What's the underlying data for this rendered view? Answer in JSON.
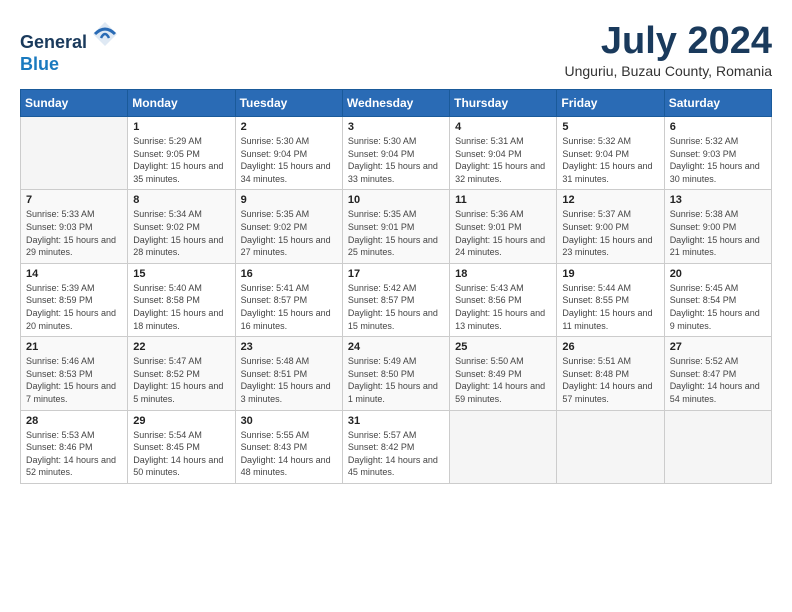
{
  "logo": {
    "line1": "General",
    "line2": "Blue"
  },
  "header": {
    "month": "July 2024",
    "location": "Unguriu, Buzau County, Romania"
  },
  "weekdays": [
    "Sunday",
    "Monday",
    "Tuesday",
    "Wednesday",
    "Thursday",
    "Friday",
    "Saturday"
  ],
  "weeks": [
    [
      {
        "day": "",
        "sunrise": "",
        "sunset": "",
        "daylight": ""
      },
      {
        "day": "1",
        "sunrise": "Sunrise: 5:29 AM",
        "sunset": "Sunset: 9:05 PM",
        "daylight": "Daylight: 15 hours and 35 minutes."
      },
      {
        "day": "2",
        "sunrise": "Sunrise: 5:30 AM",
        "sunset": "Sunset: 9:04 PM",
        "daylight": "Daylight: 15 hours and 34 minutes."
      },
      {
        "day": "3",
        "sunrise": "Sunrise: 5:30 AM",
        "sunset": "Sunset: 9:04 PM",
        "daylight": "Daylight: 15 hours and 33 minutes."
      },
      {
        "day": "4",
        "sunrise": "Sunrise: 5:31 AM",
        "sunset": "Sunset: 9:04 PM",
        "daylight": "Daylight: 15 hours and 32 minutes."
      },
      {
        "day": "5",
        "sunrise": "Sunrise: 5:32 AM",
        "sunset": "Sunset: 9:04 PM",
        "daylight": "Daylight: 15 hours and 31 minutes."
      },
      {
        "day": "6",
        "sunrise": "Sunrise: 5:32 AM",
        "sunset": "Sunset: 9:03 PM",
        "daylight": "Daylight: 15 hours and 30 minutes."
      }
    ],
    [
      {
        "day": "7",
        "sunrise": "Sunrise: 5:33 AM",
        "sunset": "Sunset: 9:03 PM",
        "daylight": "Daylight: 15 hours and 29 minutes."
      },
      {
        "day": "8",
        "sunrise": "Sunrise: 5:34 AM",
        "sunset": "Sunset: 9:02 PM",
        "daylight": "Daylight: 15 hours and 28 minutes."
      },
      {
        "day": "9",
        "sunrise": "Sunrise: 5:35 AM",
        "sunset": "Sunset: 9:02 PM",
        "daylight": "Daylight: 15 hours and 27 minutes."
      },
      {
        "day": "10",
        "sunrise": "Sunrise: 5:35 AM",
        "sunset": "Sunset: 9:01 PM",
        "daylight": "Daylight: 15 hours and 25 minutes."
      },
      {
        "day": "11",
        "sunrise": "Sunrise: 5:36 AM",
        "sunset": "Sunset: 9:01 PM",
        "daylight": "Daylight: 15 hours and 24 minutes."
      },
      {
        "day": "12",
        "sunrise": "Sunrise: 5:37 AM",
        "sunset": "Sunset: 9:00 PM",
        "daylight": "Daylight: 15 hours and 23 minutes."
      },
      {
        "day": "13",
        "sunrise": "Sunrise: 5:38 AM",
        "sunset": "Sunset: 9:00 PM",
        "daylight": "Daylight: 15 hours and 21 minutes."
      }
    ],
    [
      {
        "day": "14",
        "sunrise": "Sunrise: 5:39 AM",
        "sunset": "Sunset: 8:59 PM",
        "daylight": "Daylight: 15 hours and 20 minutes."
      },
      {
        "day": "15",
        "sunrise": "Sunrise: 5:40 AM",
        "sunset": "Sunset: 8:58 PM",
        "daylight": "Daylight: 15 hours and 18 minutes."
      },
      {
        "day": "16",
        "sunrise": "Sunrise: 5:41 AM",
        "sunset": "Sunset: 8:57 PM",
        "daylight": "Daylight: 15 hours and 16 minutes."
      },
      {
        "day": "17",
        "sunrise": "Sunrise: 5:42 AM",
        "sunset": "Sunset: 8:57 PM",
        "daylight": "Daylight: 15 hours and 15 minutes."
      },
      {
        "day": "18",
        "sunrise": "Sunrise: 5:43 AM",
        "sunset": "Sunset: 8:56 PM",
        "daylight": "Daylight: 15 hours and 13 minutes."
      },
      {
        "day": "19",
        "sunrise": "Sunrise: 5:44 AM",
        "sunset": "Sunset: 8:55 PM",
        "daylight": "Daylight: 15 hours and 11 minutes."
      },
      {
        "day": "20",
        "sunrise": "Sunrise: 5:45 AM",
        "sunset": "Sunset: 8:54 PM",
        "daylight": "Daylight: 15 hours and 9 minutes."
      }
    ],
    [
      {
        "day": "21",
        "sunrise": "Sunrise: 5:46 AM",
        "sunset": "Sunset: 8:53 PM",
        "daylight": "Daylight: 15 hours and 7 minutes."
      },
      {
        "day": "22",
        "sunrise": "Sunrise: 5:47 AM",
        "sunset": "Sunset: 8:52 PM",
        "daylight": "Daylight: 15 hours and 5 minutes."
      },
      {
        "day": "23",
        "sunrise": "Sunrise: 5:48 AM",
        "sunset": "Sunset: 8:51 PM",
        "daylight": "Daylight: 15 hours and 3 minutes."
      },
      {
        "day": "24",
        "sunrise": "Sunrise: 5:49 AM",
        "sunset": "Sunset: 8:50 PM",
        "daylight": "Daylight: 15 hours and 1 minute."
      },
      {
        "day": "25",
        "sunrise": "Sunrise: 5:50 AM",
        "sunset": "Sunset: 8:49 PM",
        "daylight": "Daylight: 14 hours and 59 minutes."
      },
      {
        "day": "26",
        "sunrise": "Sunrise: 5:51 AM",
        "sunset": "Sunset: 8:48 PM",
        "daylight": "Daylight: 14 hours and 57 minutes."
      },
      {
        "day": "27",
        "sunrise": "Sunrise: 5:52 AM",
        "sunset": "Sunset: 8:47 PM",
        "daylight": "Daylight: 14 hours and 54 minutes."
      }
    ],
    [
      {
        "day": "28",
        "sunrise": "Sunrise: 5:53 AM",
        "sunset": "Sunset: 8:46 PM",
        "daylight": "Daylight: 14 hours and 52 minutes."
      },
      {
        "day": "29",
        "sunrise": "Sunrise: 5:54 AM",
        "sunset": "Sunset: 8:45 PM",
        "daylight": "Daylight: 14 hours and 50 minutes."
      },
      {
        "day": "30",
        "sunrise": "Sunrise: 5:55 AM",
        "sunset": "Sunset: 8:43 PM",
        "daylight": "Daylight: 14 hours and 48 minutes."
      },
      {
        "day": "31",
        "sunrise": "Sunrise: 5:57 AM",
        "sunset": "Sunset: 8:42 PM",
        "daylight": "Daylight: 14 hours and 45 minutes."
      },
      {
        "day": "",
        "sunrise": "",
        "sunset": "",
        "daylight": ""
      },
      {
        "day": "",
        "sunrise": "",
        "sunset": "",
        "daylight": ""
      },
      {
        "day": "",
        "sunrise": "",
        "sunset": "",
        "daylight": ""
      }
    ]
  ]
}
